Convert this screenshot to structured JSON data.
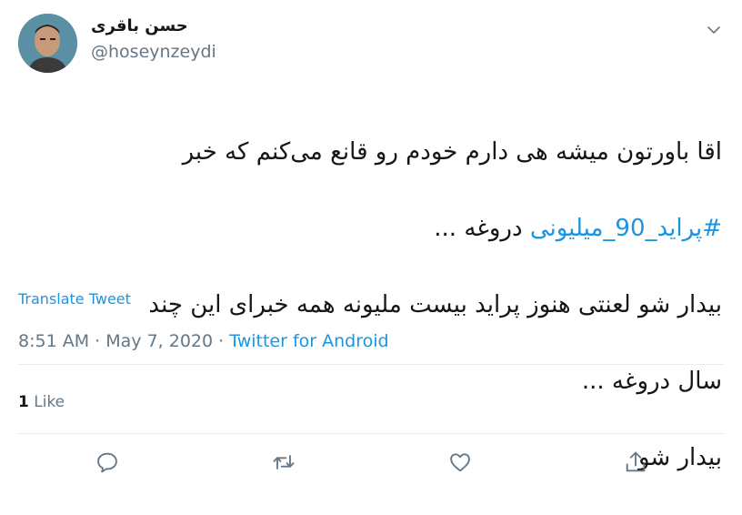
{
  "author": {
    "display_name": "حسن باقری",
    "handle": "@hoseynzeydi"
  },
  "tweet": {
    "line1": "اقا باورتون میشه هی دارم خودم رو قانع می‌کنم که خبر",
    "hashtag": "#پراید_90_میلیونی",
    "line2_rest": " دروغه ...",
    "line3": "بیدار شو لعنتی هنوز پراید بیست ملیونه همه خبرای این چند",
    "line4": "سال دروغه  ...",
    "line5": "بیدار شو"
  },
  "translate_label": "Translate Tweet",
  "meta": {
    "time": "8:51 AM",
    "separator": "·",
    "date": "May 7, 2020",
    "source": "Twitter for Android"
  },
  "stats": {
    "likes_count": "1",
    "likes_label": "Like"
  },
  "actions": {
    "reply_icon": "reply-icon",
    "retweet_icon": "retweet-icon",
    "like_icon": "heart-icon",
    "share_icon": "share-icon"
  },
  "colors": {
    "accent": "#1b95e0",
    "secondary_text": "#657786",
    "text": "#14171a",
    "divider": "#e6ecf0"
  }
}
